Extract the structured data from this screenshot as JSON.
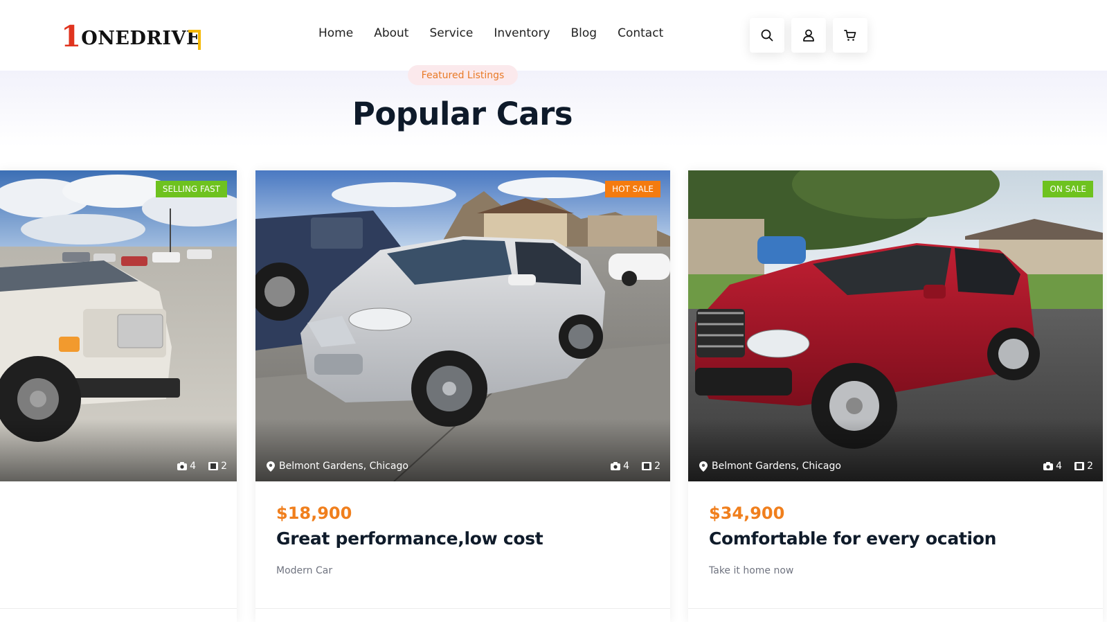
{
  "logo": {
    "digit": "1",
    "wordmark": "ONEDRIVE"
  },
  "nav": [
    {
      "label": "Home"
    },
    {
      "label": "About"
    },
    {
      "label": "Service"
    },
    {
      "label": "Inventory"
    },
    {
      "label": "Blog"
    },
    {
      "label": "Contact"
    }
  ],
  "header_icons": [
    "search-icon",
    "user-icon",
    "cart-icon"
  ],
  "section": {
    "tagline": "Featured Listings",
    "title": "Popular Cars"
  },
  "cards": [
    {
      "badge": "SELLING FAST",
      "badge_color": "#6ec21f",
      "photo_count": "4",
      "video_count": "2",
      "location": "",
      "price": "",
      "title": "",
      "subtitle": ""
    },
    {
      "badge": "HOT SALE",
      "badge_color": "#f47b0f",
      "photo_count": "4",
      "video_count": "2",
      "location": "Belmont Gardens, Chicago",
      "price": "$18,900",
      "title": "Great performance,low cost",
      "subtitle": "Modern Car"
    },
    {
      "badge": "ON SALE",
      "badge_color": "#6ec21f",
      "photo_count": "4",
      "video_count": "2",
      "location": "Belmont Gardens, Chicago",
      "price": "$34,900",
      "title": "Comfortable for every ocation",
      "subtitle": "Take it home now"
    }
  ],
  "colors": {
    "accent_price": "#f07f1d",
    "tagline_text": "#e87a27",
    "tagline_bg": "#fbe9ec",
    "heading": "#0e1a2a"
  }
}
